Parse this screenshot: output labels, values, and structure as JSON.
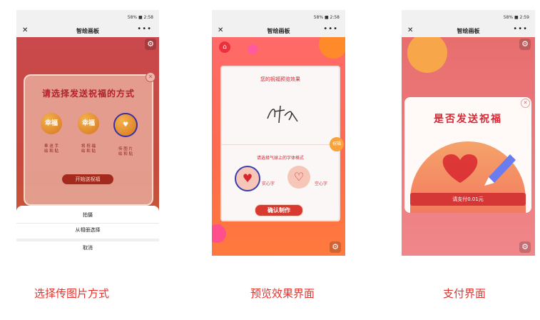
{
  "colors": {
    "accent_red": "#e3332e",
    "app_gradient_top": "#ff6a6a",
    "app_gradient_bottom": "#ff7a3d"
  },
  "status_bar": {
    "left_icons": "signal wifi",
    "right_text": "58% ■ 2:58",
    "right_text_3": "58% ■ 2:59"
  },
  "window": {
    "title": "智绘画板",
    "close_icon": "close-icon",
    "more_icon": "more-icon"
  },
  "phone1": {
    "dialog_title": "请选择发送祝福的方式",
    "options": [
      {
        "ball_text": "幸福",
        "caption_line1": "奉 送 手",
        "caption_line2": "绘 和 贴"
      },
      {
        "ball_text": "幸福",
        "caption_line1": "将 祝 福",
        "caption_line2": "绘 和 贴"
      },
      {
        "ball_text": "♥",
        "caption_line1": "传 图 片",
        "caption_line2": "绘 和 贴"
      }
    ],
    "start_button": "开始送祝福",
    "sheet": {
      "item1": "拍摄",
      "item2": "从相册选择",
      "cancel": "取消"
    }
  },
  "phone2": {
    "preview_title": "您的祝福预览效果",
    "font_prompt": "请选择气球上的字体格式",
    "font_options": [
      {
        "label": "实心字"
      },
      {
        "label": "空心字"
      }
    ],
    "confirm_button": "确认制作",
    "sticker": "祝福"
  },
  "phone3": {
    "pay_title": "是否发送祝福",
    "pay_button": "请支付0.01元"
  },
  "captions": {
    "c1": "选择传图片方式",
    "c2": "预览效果界面",
    "c3": "支付界面"
  }
}
